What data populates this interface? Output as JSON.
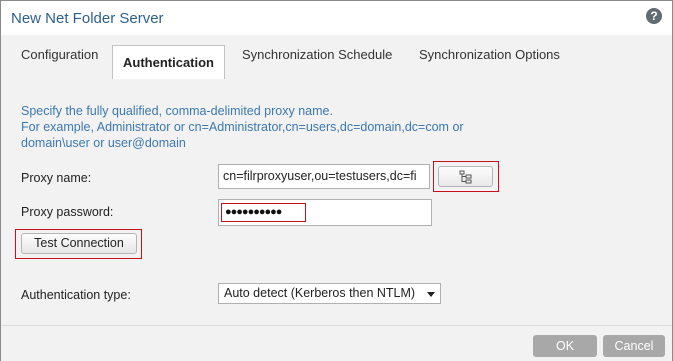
{
  "dialog": {
    "title": "New Net Folder Server",
    "help_glyph": "?"
  },
  "tabs": [
    {
      "label": "Configuration",
      "active": false
    },
    {
      "label": "Authentication",
      "active": true
    },
    {
      "label": "Synchronization Schedule",
      "active": false
    },
    {
      "label": "Synchronization Options",
      "active": false
    }
  ],
  "hint": {
    "line1": "Specify the fully qualified, comma-delimited proxy name.",
    "line2": "For example, Administrator or cn=Administrator,cn=users,dc=domain,dc=com or",
    "line3": "domain\\user or user@domain"
  },
  "proxy_name": {
    "label": "Proxy name:",
    "value": "cn=filrproxyuser,ou=testusers,dc=fi",
    "browse_icon": "tree-icon"
  },
  "proxy_password": {
    "label": "Proxy password:",
    "masked_value": "●●●●●●●●●●"
  },
  "test_connection": {
    "label": "Test Connection"
  },
  "auth_type": {
    "label": "Authentication type:",
    "selected": "Auto detect (Kerberos then NTLM)"
  },
  "footer": {
    "ok_label": "OK",
    "cancel_label": "Cancel"
  },
  "colors": {
    "title": "#2d5f8f",
    "hint": "#3d78b0",
    "highlight": "#c8101c",
    "footer_button": "#a8a8a8"
  }
}
